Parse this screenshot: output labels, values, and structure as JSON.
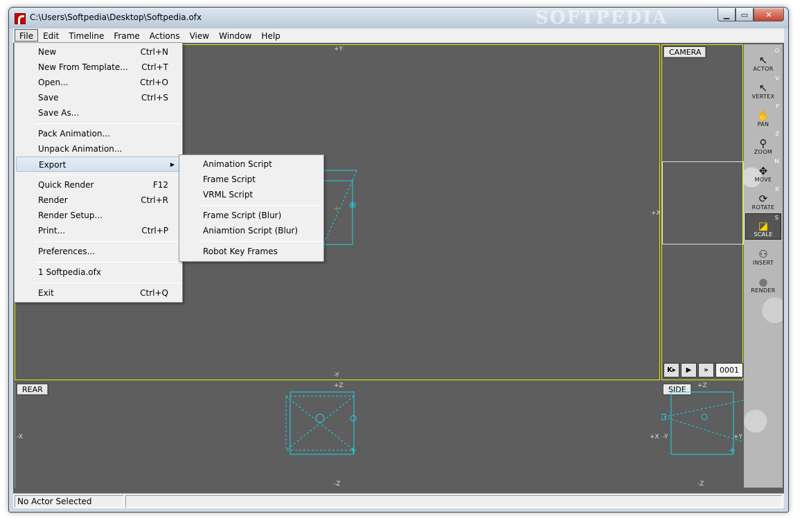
{
  "window": {
    "title": "C:\\Users\\Softpedia\\Desktop\\Softpedia.ofx",
    "watermark": "SOFTPEDIA",
    "min_glyph": "▁",
    "max_glyph": "▭",
    "close_glyph": "✕"
  },
  "menubar": [
    "File",
    "Edit",
    "Timeline",
    "Frame",
    "Actions",
    "View",
    "Window",
    "Help"
  ],
  "file_menu": {
    "items": [
      {
        "label": "New",
        "shortcut": "Ctrl+N"
      },
      {
        "label": "New From Template...",
        "shortcut": "Ctrl+T"
      },
      {
        "label": "Open...",
        "shortcut": "Ctrl+O"
      },
      {
        "label": "Save",
        "shortcut": "Ctrl+S"
      },
      {
        "label": "Save As...",
        "shortcut": ""
      },
      {
        "label": "Pack Animation...",
        "shortcut": ""
      },
      {
        "label": "Unpack Animation...",
        "shortcut": ""
      },
      {
        "label": "Export",
        "shortcut": ""
      },
      {
        "label": "Quick Render",
        "shortcut": "F12"
      },
      {
        "label": "Render",
        "shortcut": "Ctrl+R"
      },
      {
        "label": "Render Setup...",
        "shortcut": ""
      },
      {
        "label": "Print...",
        "shortcut": "Ctrl+P"
      },
      {
        "label": "Preferences...",
        "shortcut": ""
      },
      {
        "label": "1 Softpedia.ofx",
        "shortcut": ""
      },
      {
        "label": "Exit",
        "shortcut": "Ctrl+Q"
      }
    ]
  },
  "export_menu": {
    "items": [
      {
        "label": "Animation Script"
      },
      {
        "label": "Frame Script"
      },
      {
        "label": "VRML Script"
      },
      {
        "label": "Frame Script (Blur)"
      },
      {
        "label": "Aniamtion Script (Blur)"
      },
      {
        "label": "Robot Key Frames"
      }
    ]
  },
  "viewports": {
    "main": {
      "top_axis": "+Y",
      "bottom_axis": "-Y",
      "right_axis": "+X"
    },
    "camera": {
      "label": "CAMERA"
    },
    "rear": {
      "label": "REAR",
      "top_axis": "+Z",
      "bottom_axis": "-Z",
      "left_axis": "-X",
      "right_axis": "+X"
    },
    "side": {
      "label": "SIDE",
      "top_axis": "+Z",
      "bottom_axis": "-Z",
      "left_axis": "-Y",
      "right_axis": "+Y"
    }
  },
  "playbar": {
    "rewind": "K▸",
    "play": "▶",
    "fast_forward": "»",
    "frame": "0001"
  },
  "toolbar": [
    {
      "name": "ACTOR",
      "key": "O",
      "glyph": "↖"
    },
    {
      "name": "VERTEX",
      "key": "V",
      "glyph": "↖"
    },
    {
      "name": "PAN",
      "key": "P",
      "glyph": "✋"
    },
    {
      "name": "ZOOM",
      "key": "Z",
      "glyph": "⚲"
    },
    {
      "name": "MOVE",
      "key": "M",
      "glyph": "✥"
    },
    {
      "name": "ROTATE",
      "key": "R",
      "glyph": "⟳"
    },
    {
      "name": "SCALE",
      "key": "S",
      "glyph": "◪"
    },
    {
      "name": "INSERT",
      "key": "",
      "glyph": "⚇"
    },
    {
      "name": "RENDER",
      "key": "",
      "glyph": "●"
    }
  ],
  "status": {
    "text": "No Actor Selected"
  }
}
